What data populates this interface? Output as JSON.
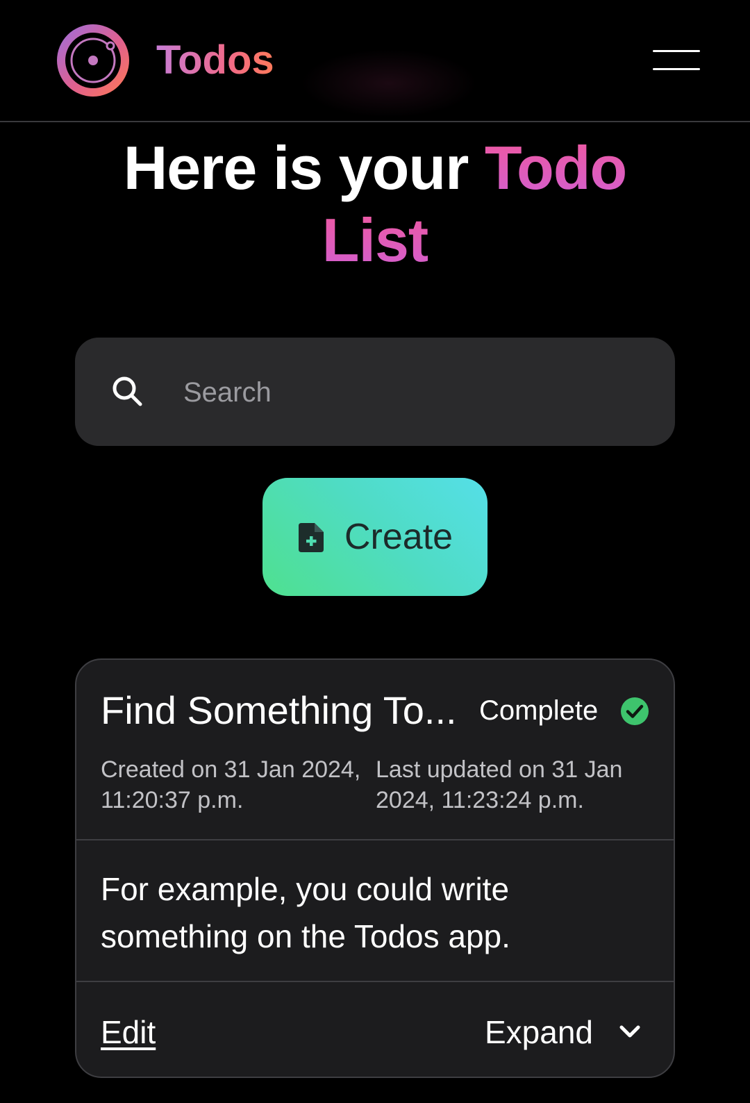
{
  "app": {
    "brand": "Todos",
    "accent_gradient": [
      "#c77dd6",
      "#f06a8a",
      "#ff7a5a"
    ]
  },
  "header": {
    "logo_icon": "orbit-logo-icon",
    "menu_icon": "hamburger-menu-icon"
  },
  "heading": {
    "prefix": "Here is your ",
    "accent_line1": "Todo",
    "accent_line2": "List",
    "accent_color": "#e25bb5"
  },
  "search": {
    "placeholder": "Search",
    "value": "",
    "icon": "search-icon"
  },
  "create_button": {
    "label": "Create",
    "icon": "file-plus-icon",
    "gradient": [
      "#4fe08f",
      "#55dfe8"
    ]
  },
  "todos": [
    {
      "title": "Find Something To...",
      "status": "Complete",
      "status_icon": "check-circle-icon",
      "status_color": "#3ec46d",
      "created": "Created on 31 Jan 2024, 11:20:37 p.m.",
      "updated": "Last updated on 31 Jan 2024, 11:23:24 p.m.",
      "body": "For example, you could write something on the Todos app.",
      "edit_label": "Edit",
      "expand_label": "Expand",
      "expand_icon": "chevron-down-icon"
    }
  ]
}
